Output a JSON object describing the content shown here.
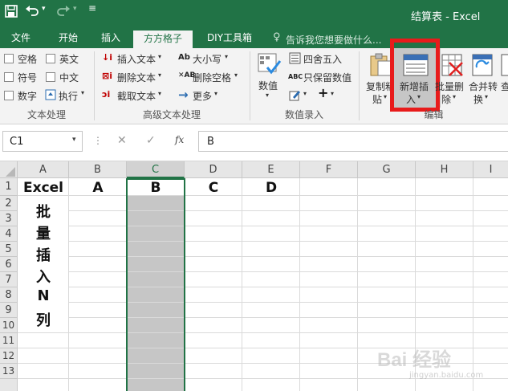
{
  "window": {
    "title": "结算表 - Excel"
  },
  "tabs": [
    "文件",
    "开始",
    "插入",
    "方方格子",
    "DIY工具箱"
  ],
  "tell_me": "告诉我您想要做什么...",
  "ribbon": {
    "text_group": {
      "label": "文本处理",
      "checkboxes": [
        "空格",
        "英文",
        "符号",
        "中文",
        "数字"
      ],
      "execute": "执行"
    },
    "adv_group": {
      "label": "高级文本处理",
      "items": [
        "插入文本",
        "删除文本",
        "截取文本",
        "大小写",
        "删除空格",
        "更多"
      ]
    },
    "num_group": {
      "label": "数值录入",
      "value_button": "数值",
      "round": "四舍五入",
      "keep_value": "只保留数值"
    },
    "edit_group": {
      "label": "编辑",
      "copy": [
        "复制粘",
        "贴"
      ],
      "new_insert": [
        "新增插",
        "入"
      ],
      "batch_delete": [
        "批量删",
        "除"
      ],
      "merge": [
        "合并转",
        "换"
      ],
      "more": "查"
    }
  },
  "formula_bar": {
    "name_box": "C1",
    "content": "B",
    "fx": "fx"
  },
  "columns": [
    "A",
    "B",
    "C",
    "D",
    "E",
    "F",
    "G",
    "H",
    "I"
  ],
  "rows": [
    "1",
    "2",
    "3",
    "4",
    "5",
    "6",
    "7",
    "8",
    "9",
    "10",
    "11",
    "12",
    "13"
  ],
  "cells": {
    "A1": "Excel",
    "B1": "A",
    "C1": "B",
    "D1": "C",
    "E1": "D"
  },
  "a_column_chars": [
    "批",
    "量",
    "插",
    "入",
    "N",
    "列"
  ],
  "watermark": {
    "text": "Bai 经验",
    "sub": "jingyan.baidu.com"
  },
  "colors": {
    "excel_green": "#217346",
    "highlight": "#e81b1b",
    "selected_col": "#c6c6c6"
  }
}
